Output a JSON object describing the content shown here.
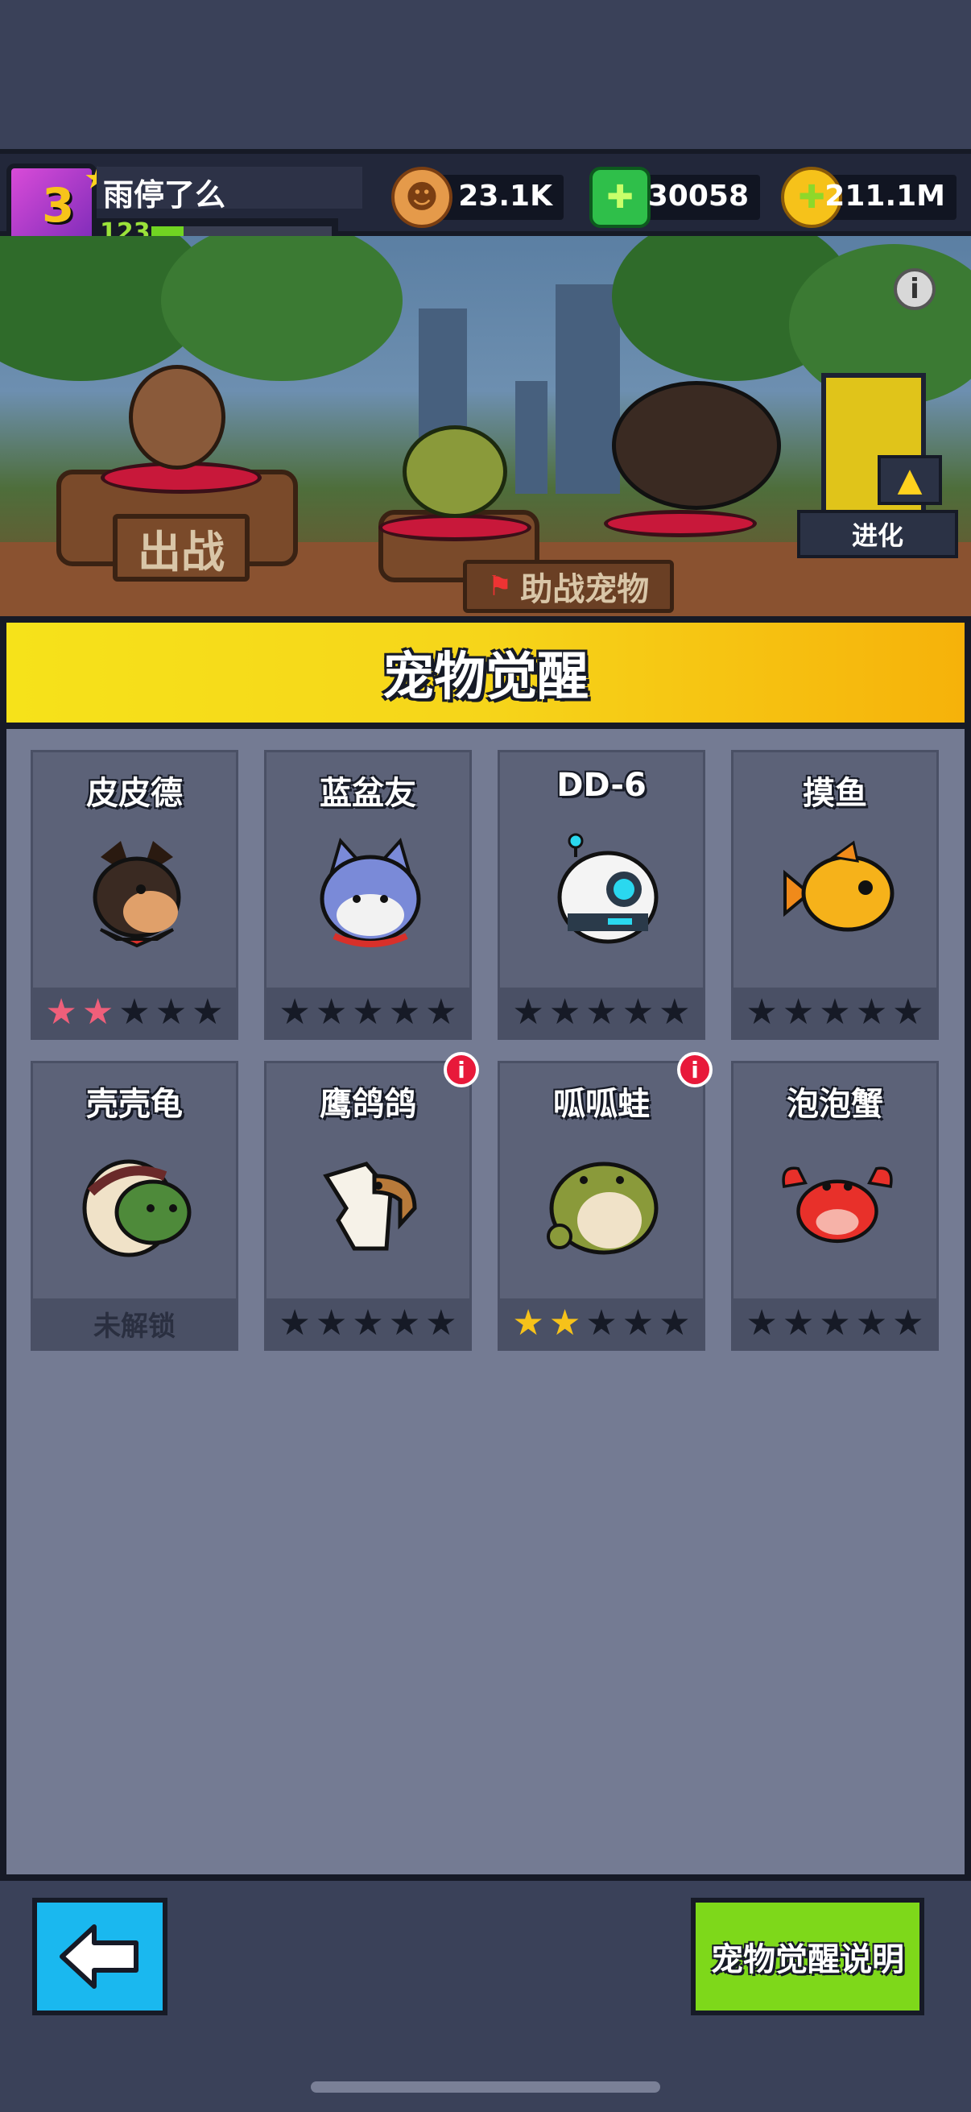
{
  "header": {
    "player_name": "雨停了么",
    "avatar_level": "3",
    "player_level": "123",
    "xp_progress": 0.18,
    "resources": [
      {
        "icon": "bone-coin-icon",
        "value": "23.1K"
      },
      {
        "icon": "green-gem-icon",
        "value": "30058"
      },
      {
        "icon": "gold-coin-icon",
        "value": "211.1M"
      }
    ]
  },
  "scene": {
    "fight_sign": "出战",
    "support_sign": "助战宠物",
    "evolve_label": "进化"
  },
  "panel": {
    "title": "宠物觉醒",
    "pets": [
      {
        "name": "皮皮德",
        "icon": "shepherd-dog-icon",
        "stars": 2,
        "star_color": "pink",
        "locked": false,
        "badge": false
      },
      {
        "name": "蓝盆友",
        "icon": "blue-cat-icon",
        "stars": 0,
        "star_color": "",
        "locked": false,
        "badge": false
      },
      {
        "name": "DD-6",
        "icon": "robot-icon",
        "stars": 0,
        "star_color": "",
        "locked": false,
        "badge": false
      },
      {
        "name": "摸鱼",
        "icon": "goldfish-icon",
        "stars": 0,
        "star_color": "",
        "locked": false,
        "badge": false
      },
      {
        "name": "壳壳龟",
        "icon": "turtle-icon",
        "stars": 0,
        "star_color": "",
        "locked": true,
        "badge": false,
        "locked_label": "未解锁"
      },
      {
        "name": "鹰鸽鸽",
        "icon": "eagle-icon",
        "stars": 0,
        "star_color": "",
        "locked": false,
        "badge": true
      },
      {
        "name": "呱呱蛙",
        "icon": "frog-icon",
        "stars": 2,
        "star_color": "gold",
        "locked": false,
        "badge": true
      },
      {
        "name": "泡泡蟹",
        "icon": "crab-icon",
        "stars": 0,
        "star_color": "",
        "locked": false,
        "badge": false
      }
    ]
  },
  "footer": {
    "help_button": "宠物觉醒说明"
  },
  "colors": {
    "title_bar": "#f6d51a",
    "back_button": "#1ab8ef",
    "help_button": "#7ed81a",
    "badge": "#e8193a"
  }
}
